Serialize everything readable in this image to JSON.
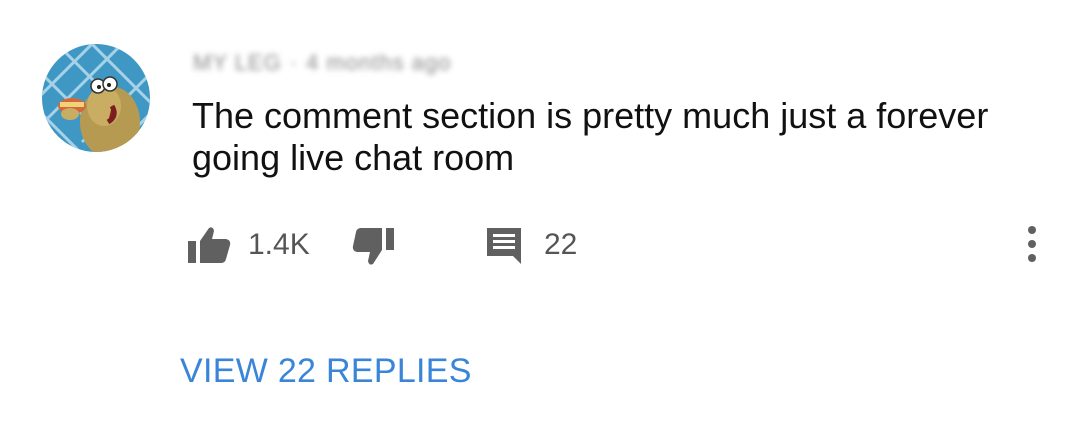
{
  "comment": {
    "author": "MY LEG",
    "age": "4 months ago",
    "separator": "·",
    "text": "The comment section is pretty much just a forever going live chat room",
    "likes": "1.4K",
    "replies_count": "22",
    "view_replies_label": "VIEW 22 REPLIES"
  },
  "icons": {
    "avatar": "cartoon-character-avatar",
    "like": "thumbs-up-icon",
    "dislike": "thumbs-down-icon",
    "reply": "comment-bubble-icon",
    "more": "vertical-ellipsis-icon"
  },
  "colors": {
    "text": "#111111",
    "secondary_text": "#555555",
    "icon": "#606060",
    "link": "#3a85d8"
  }
}
